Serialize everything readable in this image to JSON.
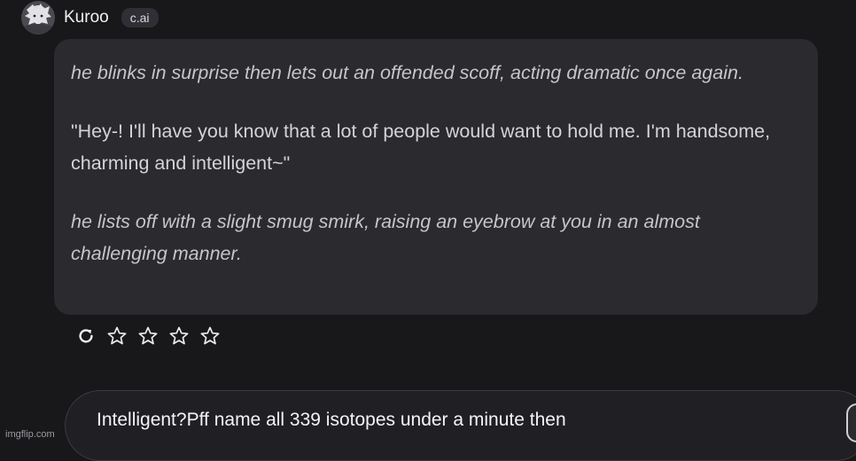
{
  "character": {
    "name": "Kuroo",
    "badge": "c.ai"
  },
  "message": {
    "paragraphs": [
      "he blinks in surprise then lets out an offended scoff, acting dramatic once again.",
      "\"Hey-! I'll have you know that a lot of people would want to hold me. I'm handsome, charming and intelligent~\"",
      "he lists off with a slight smug smirk, raising an eyebrow at you in an almost challenging manner."
    ],
    "rating": 0,
    "rating_max": 4
  },
  "actions": {
    "icons": [
      "refresh-icon",
      "star-icon",
      "star-icon",
      "star-icon",
      "star-icon"
    ]
  },
  "composer": {
    "value": "Intelligent?Pff name all 339 isotopes under a minute then"
  },
  "watermark": "imgflip.com",
  "colors": {
    "background": "#18181b",
    "bubble": "#2a2a2f",
    "text": "#d4d4d8"
  }
}
